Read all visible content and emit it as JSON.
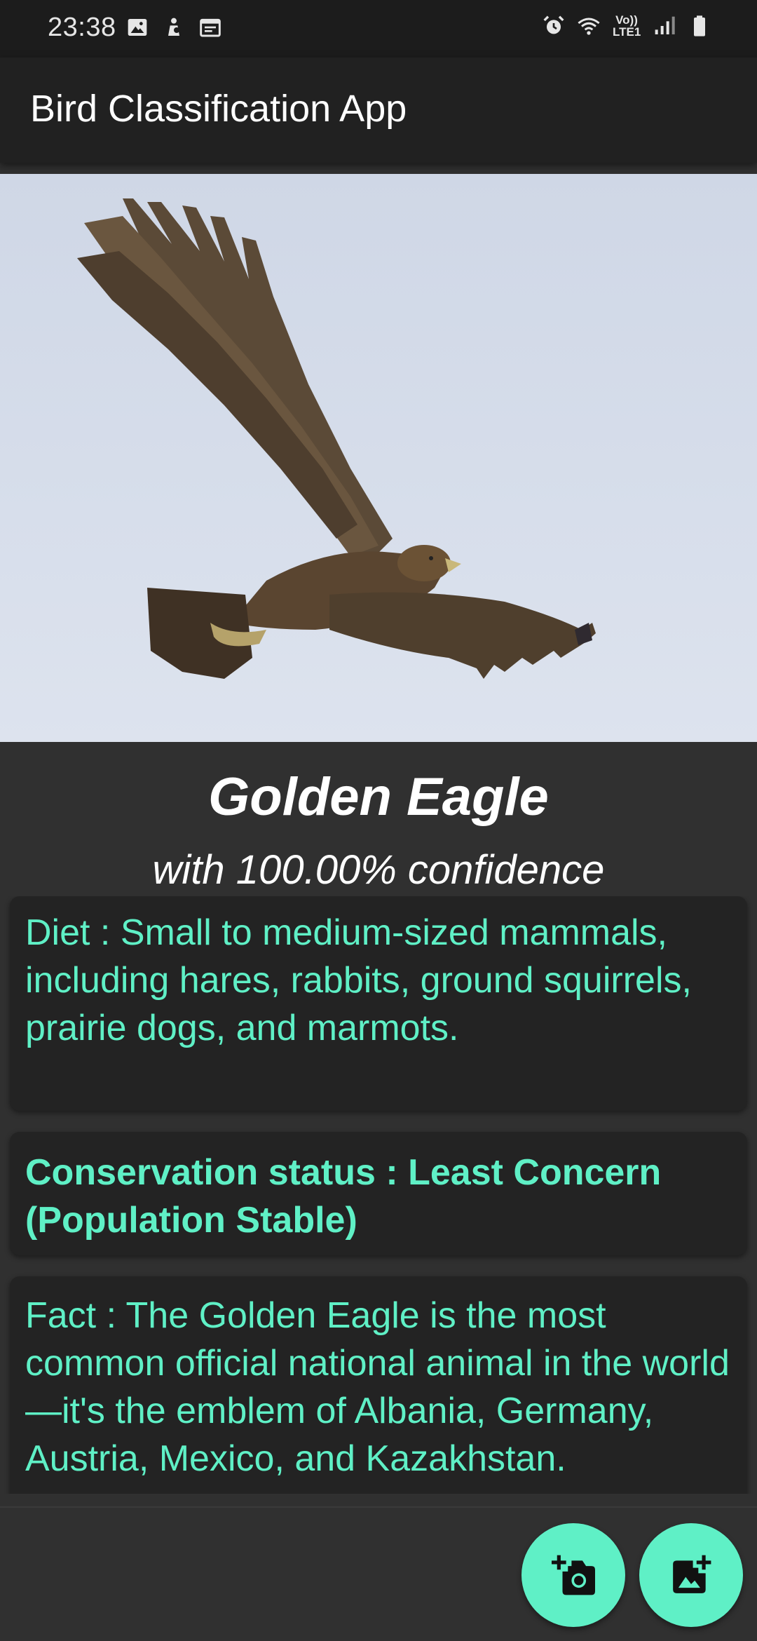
{
  "status_bar": {
    "time": "23:38",
    "network_label_top": "Vo))",
    "network_label_bottom": "LTE1",
    "left_icons": [
      "image-icon",
      "android-person-icon",
      "calendar-icon"
    ],
    "right_icons": [
      "alarm-icon",
      "wifi-icon",
      "signal-icon",
      "battery-icon"
    ]
  },
  "app_bar": {
    "title": "Bird Classification App"
  },
  "result": {
    "species": "Golden Eagle",
    "confidence_text": "with 100.00% confidence"
  },
  "cards": {
    "diet": "Diet : Small to medium-sized mammals, including hares, rabbits, ground squirrels, prairie dogs, and marmots.",
    "conservation": "Conservation status : Least Concern (Population Stable)",
    "fact": "Fact : The Golden Eagle is the most common official national animal in the world—it's the emblem of Albania, Germany, Austria, Mexico, and Kazakhstan."
  },
  "fabs": {
    "camera_icon": "add-a-photo-icon",
    "gallery_icon": "add-photo-alternate-icon"
  },
  "colors": {
    "accent": "#5ff0c6",
    "background": "#303030",
    "app_bar": "#212121",
    "card": "#232323"
  }
}
